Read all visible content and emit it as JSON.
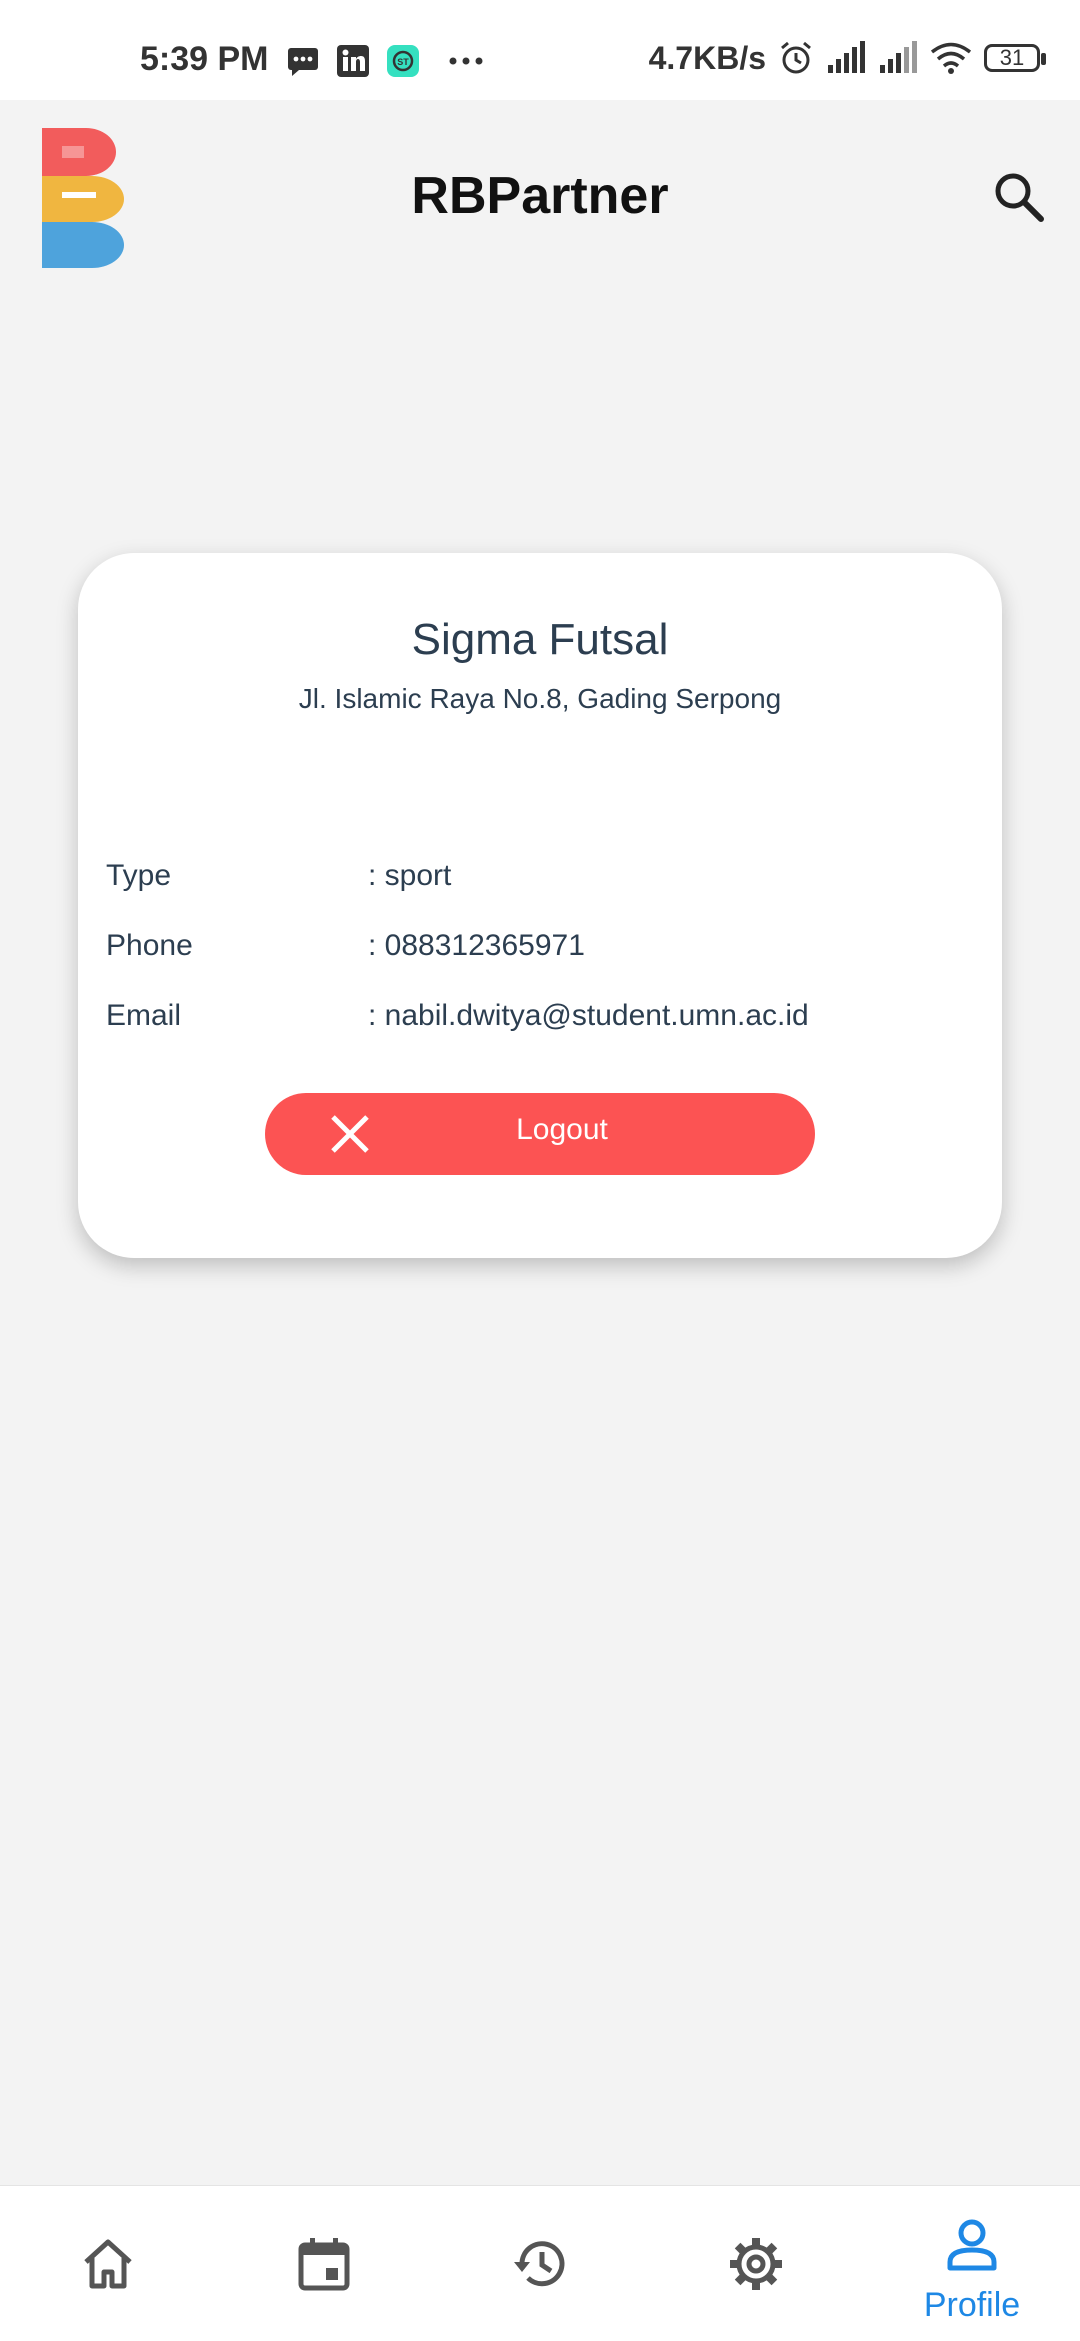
{
  "status_bar": {
    "time": "5:39 PM",
    "network_speed": "4.7KB/s",
    "battery_level": "31",
    "icons": [
      "message-icon",
      "linkedin-icon",
      "app-notification-icon",
      "more-dots-icon",
      "alarm-icon",
      "signal-icon",
      "signal-icon",
      "wifi-icon",
      "battery-icon"
    ]
  },
  "app_bar": {
    "title": "RBPartner",
    "logo_icon": "rb-logo",
    "search_icon": "search-icon"
  },
  "profile": {
    "name": "Sigma Futsal",
    "address": "Jl. Islamic Raya No.8, Gading Serpong",
    "details": [
      {
        "label": "Type",
        "value": ": sport"
      },
      {
        "label": "Phone",
        "value": ": 088312365971"
      },
      {
        "label": "Email",
        "value": ": nabil.dwitya@student.umn.ac.id"
      }
    ],
    "logout_label": "Logout",
    "logout_icon": "close-icon"
  },
  "bottom_nav": {
    "items": [
      {
        "icon": "home-icon",
        "label": ""
      },
      {
        "icon": "calendar-icon",
        "label": ""
      },
      {
        "icon": "history-icon",
        "label": ""
      },
      {
        "icon": "gear-icon",
        "label": ""
      },
      {
        "icon": "person-icon",
        "label": "Profile"
      }
    ],
    "active_index": 4
  },
  "colors": {
    "accent": "#1e88e5",
    "logout": "#fc5353",
    "text": "#2c3e50",
    "background": "#f3f3f3"
  }
}
